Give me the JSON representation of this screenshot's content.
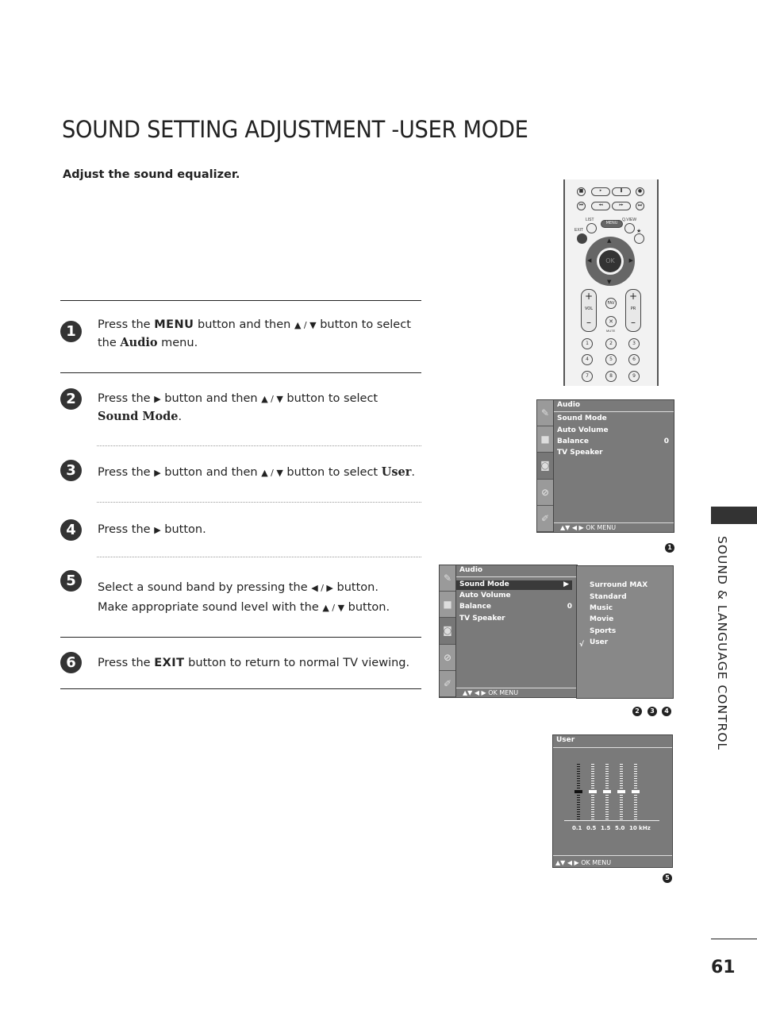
{
  "page": {
    "title": "SOUND SETTING ADJUSTMENT -USER MODE",
    "subtitle": "Adjust the sound equalizer.",
    "section_tab": "SOUND & LANGUAGE CONTROL",
    "page_number": "61"
  },
  "steps": [
    {
      "num": "1",
      "line1": [
        "Press the ",
        "MENU",
        " button and then ",
        "▲ / ▼",
        " button to select"
      ],
      "line2": [
        "the ",
        "Audio",
        " menu."
      ]
    },
    {
      "num": "2",
      "line1": [
        "Press the ",
        "▶",
        " button and then ",
        "▲ / ▼",
        " button to select"
      ],
      "line2": [
        "",
        "Sound Mode",
        "."
      ]
    },
    {
      "num": "3",
      "line1": [
        "Press the ",
        "▶",
        " button and then ",
        "▲ / ▼",
        " button to select ",
        "User",
        "."
      ]
    },
    {
      "num": "4",
      "line1": [
        "Press the ",
        "▶",
        " button."
      ]
    },
    {
      "num": "5",
      "line1": [
        "Select a sound band by pressing the ",
        "◀ / ▶",
        " button."
      ],
      "line2": [
        "Make appropriate sound level with the ",
        "▲ / ▼",
        " button."
      ]
    },
    {
      "num": "6",
      "line1": [
        "Press the ",
        "EXIT",
        " button to return to normal TV viewing."
      ]
    }
  ],
  "remote": {
    "labels": {
      "list": "LIST",
      "menu": "MENU",
      "qview": "Q.VIEW",
      "exit": "EXIT",
      "ok": "OK",
      "vol": "VOL",
      "pr": "PR",
      "fav": "FAV",
      "mute": "MUTE",
      "star": "★"
    },
    "numbers": [
      "1",
      "2",
      "3",
      "4",
      "5",
      "6",
      "7",
      "8",
      "9"
    ]
  },
  "osd1": {
    "header": "Audio",
    "items": [
      {
        "label": "Sound Mode",
        "value": ""
      },
      {
        "label": "Auto Volume",
        "value": ""
      },
      {
        "label": "Balance",
        "value": "0"
      },
      {
        "label": "TV Speaker",
        "value": ""
      }
    ],
    "footer": "▲▼  ◀ ▶  OK  MENU",
    "badge": "1"
  },
  "osd2": {
    "header": "Audio",
    "items": [
      {
        "label": "Sound Mode",
        "value": "▶",
        "selected": true
      },
      {
        "label": "Auto Volume",
        "value": ""
      },
      {
        "label": "Balance",
        "value": "0"
      },
      {
        "label": "TV Speaker",
        "value": ""
      }
    ],
    "submenu": [
      "Surround MAX",
      "Standard",
      "Music",
      "Movie",
      "Sports",
      "User"
    ],
    "checked": "User",
    "check_mark": "√",
    "footer": "▲▼  ◀ ▶  OK  MENU",
    "badges": [
      "2",
      "3",
      "4"
    ]
  },
  "osd3": {
    "header": "User",
    "bands": [
      {
        "label": "0.1",
        "level": 0.5,
        "active": true
      },
      {
        "label": "0.5",
        "level": 0.5,
        "active": false
      },
      {
        "label": "1.5",
        "level": 0.5,
        "active": false
      },
      {
        "label": "5.0",
        "level": 0.5,
        "active": false
      },
      {
        "label": "10 kHz",
        "level": 0.5,
        "active": false
      }
    ],
    "footer": "▲▼  ◀ ▶  OK  MENU",
    "badge": "5"
  }
}
